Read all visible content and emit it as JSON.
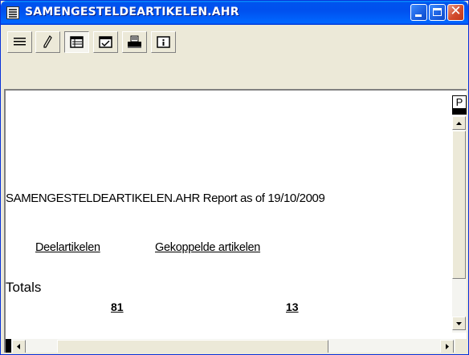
{
  "window": {
    "title": "SAMENGESTELDEARTIKELEN.AHR",
    "app_icon": "report-app-icon"
  },
  "title_buttons": [
    "minimize-icon",
    "maximize-icon",
    "close-icon"
  ],
  "toolbar": {
    "tools": [
      {
        "icon": "lines-menu-icon"
      },
      {
        "icon": "pencil-icon"
      },
      {
        "icon": "table-view-icon",
        "pressed": true
      },
      {
        "icon": "checklist-icon"
      },
      {
        "icon": "printer-icon"
      },
      {
        "icon": "info-icon"
      }
    ]
  },
  "report": {
    "heading": "SAMENGESTELDEARTIKELEN.AHR Report as of 19/10/2009",
    "columns": [
      "Deelartikelen",
      "Gekoppelde artikelen"
    ],
    "totals_label": "Totals",
    "totals": [
      "81",
      "13"
    ]
  },
  "scrollbar": {
    "marker": "P"
  }
}
